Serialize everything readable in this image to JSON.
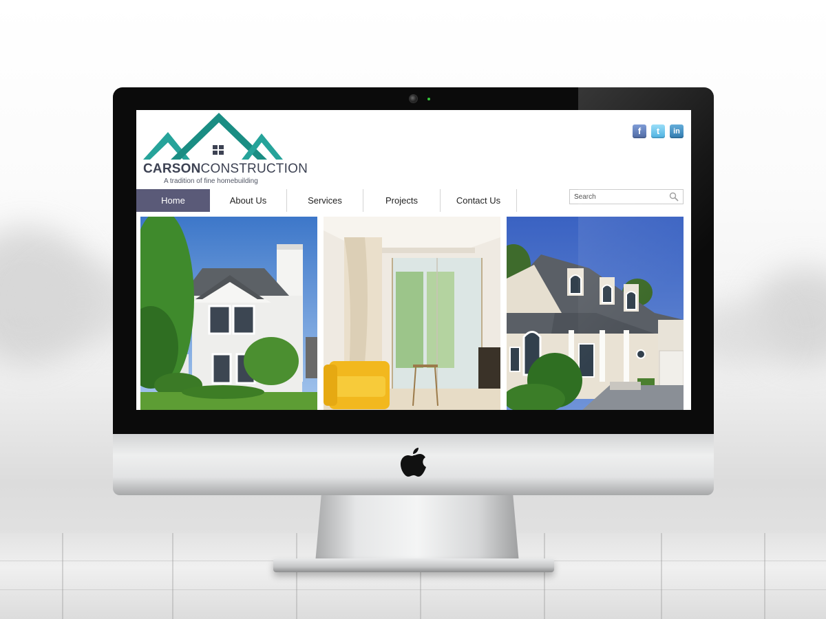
{
  "site": {
    "brand_bold": "CARSON",
    "brand_rest": "CONSTRUCTION",
    "tagline": "A tradition of fine homebuilding"
  },
  "nav": {
    "items": [
      {
        "label": "Home",
        "active": true
      },
      {
        "label": "About Us",
        "active": false
      },
      {
        "label": "Services",
        "active": false
      },
      {
        "label": "Projects",
        "active": false
      },
      {
        "label": "Contact Us",
        "active": false
      }
    ]
  },
  "search": {
    "placeholder": "Search"
  },
  "social": [
    {
      "name": "facebook-icon",
      "glyph": "f"
    },
    {
      "name": "twitter-icon",
      "glyph": "t"
    },
    {
      "name": "linkedin-icon",
      "glyph": "in"
    }
  ],
  "gallery": [
    {
      "name": "photo-white-house-exterior"
    },
    {
      "name": "photo-glass-shower-interior"
    },
    {
      "name": "photo-cream-house-exterior"
    }
  ],
  "colors": {
    "brand_teal": "#1e9b8f",
    "nav_active": "#5a5a78",
    "brand_text": "#3d4253"
  }
}
